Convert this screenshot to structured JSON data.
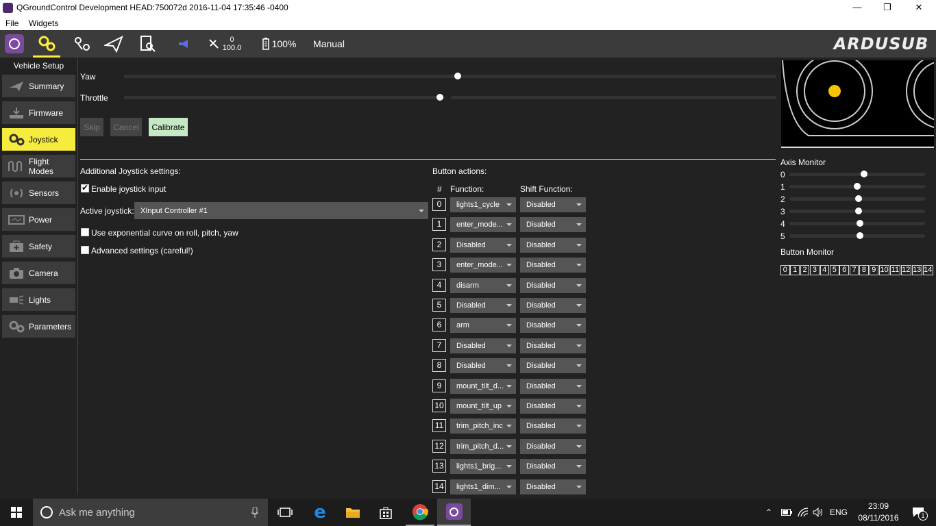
{
  "window": {
    "title": "QGroundControl Development HEAD:750072d 2016-11-04 17:35:46 -0400",
    "min": "—",
    "max": "❐",
    "close": "✕"
  },
  "menu": {
    "file": "File",
    "widgets": "Widgets"
  },
  "toolbar": {
    "gps_count": "0",
    "hdop": "100.0",
    "battery": "100%",
    "mode": "Manual",
    "logo": "ARDUSUB",
    "accent": "#ffeb3b"
  },
  "sidebar": {
    "header": "Vehicle Setup",
    "items": [
      {
        "label": "Summary",
        "icon": "paper-plane-icon"
      },
      {
        "label": "Firmware",
        "icon": "download-icon"
      },
      {
        "label": "Joystick",
        "icon": "gears-icon"
      },
      {
        "label": "Flight Modes",
        "icon": "waveform-icon"
      },
      {
        "label": "Sensors",
        "icon": "radio-icon"
      },
      {
        "label": "Power",
        "icon": "power-icon"
      },
      {
        "label": "Safety",
        "icon": "medkit-icon"
      },
      {
        "label": "Camera",
        "icon": "camera-icon"
      },
      {
        "label": "Lights",
        "icon": "light-icon"
      },
      {
        "label": "Parameters",
        "icon": "gears-icon"
      }
    ],
    "active_color": "#f6ec3e"
  },
  "calibration": {
    "yaw_label": "Yaw",
    "yaw_value": 0.5,
    "throttle_label": "Throttle",
    "throttle_value": 0.5,
    "skip": "Skip",
    "cancel": "Cancel",
    "calibrate": "Calibrate"
  },
  "settings": {
    "header": "Additional Joystick settings:",
    "enable_label": "Enable joystick input",
    "enable_checked": true,
    "active_label": "Active joystick:",
    "active_value": "XInput Controller #1",
    "expo_label": "Use exponential curve on roll, pitch, yaw",
    "expo_checked": false,
    "advanced_label": "Advanced settings (careful!)",
    "advanced_checked": false
  },
  "buttons": {
    "header": "Button actions:",
    "col_index": "#",
    "col_function": "Function:",
    "col_shift": "Shift Function:",
    "rows": [
      {
        "index": "0",
        "function": "lights1_cycle",
        "shift": "Disabled"
      },
      {
        "index": "1",
        "function": "enter_mode...",
        "shift": "Disabled"
      },
      {
        "index": "2",
        "function": "Disabled",
        "shift": "Disabled"
      },
      {
        "index": "3",
        "function": "enter_mode...",
        "shift": "Disabled"
      },
      {
        "index": "4",
        "function": "disarm",
        "shift": "Disabled"
      },
      {
        "index": "5",
        "function": "Disabled",
        "shift": "Disabled"
      },
      {
        "index": "6",
        "function": "arm",
        "shift": "Disabled"
      },
      {
        "index": "7",
        "function": "Disabled",
        "shift": "Disabled"
      },
      {
        "index": "8",
        "function": "Disabled",
        "shift": "Disabled"
      },
      {
        "index": "9",
        "function": "mount_tilt_d...",
        "shift": "Disabled"
      },
      {
        "index": "10",
        "function": "mount_tilt_up",
        "shift": "Disabled"
      },
      {
        "index": "11",
        "function": "trim_pitch_inc",
        "shift": "Disabled"
      },
      {
        "index": "12",
        "function": "trim_pitch_d...",
        "shift": "Disabled"
      },
      {
        "index": "13",
        "function": "lights1_brig...",
        "shift": "Disabled"
      },
      {
        "index": "14",
        "function": "lights1_dim...",
        "shift": "Disabled"
      }
    ]
  },
  "axis_monitor": {
    "header": "Axis Monitor",
    "axes": [
      {
        "label": "0",
        "value": 0.55
      },
      {
        "label": "1",
        "value": 0.5
      },
      {
        "label": "2",
        "value": 0.51
      },
      {
        "label": "3",
        "value": 0.51
      },
      {
        "label": "4",
        "value": 0.52
      },
      {
        "label": "5",
        "value": 0.52
      }
    ]
  },
  "button_monitor": {
    "header": "Button Monitor",
    "buttons": [
      "0",
      "1",
      "2",
      "3",
      "4",
      "5",
      "6",
      "7",
      "8",
      "9",
      "10",
      "11",
      "12",
      "13",
      "14"
    ]
  },
  "taskbar": {
    "search_placeholder": "Ask me anything",
    "lang": "ENG",
    "time": "23:09",
    "date": "08/11/2016",
    "notifications": "1"
  }
}
